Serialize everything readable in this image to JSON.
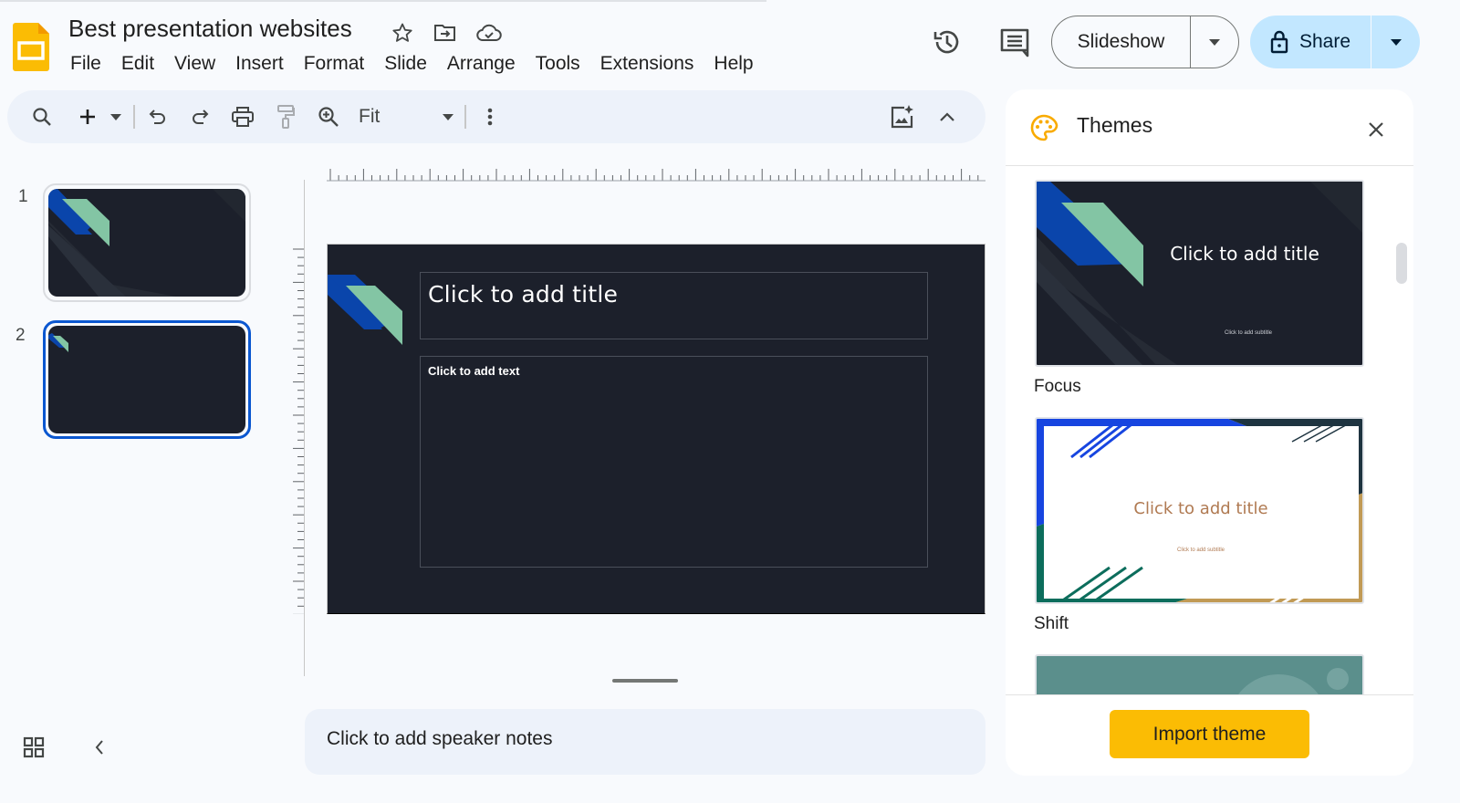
{
  "app": {
    "doc_title": "Best presentation websites",
    "logo_icon": "google-slides-logo",
    "title_icons": [
      "star-icon",
      "move-to-folder-icon",
      "cloud-saved-icon"
    ]
  },
  "menu": [
    "File",
    "Edit",
    "View",
    "Insert",
    "Format",
    "Slide",
    "Arrange",
    "Tools",
    "Extensions",
    "Help"
  ],
  "header_actions": {
    "history_icon": "version-history-icon",
    "comments_icon": "comments-icon",
    "slideshow_label": "Slideshow",
    "share_label": "Share",
    "share_icon": "lock-icon"
  },
  "toolbar": {
    "items": [
      "search-icon",
      "new-slide-plus-icon",
      "undo-icon",
      "redo-icon",
      "print-icon",
      "paint-format-icon",
      "zoom-icon"
    ],
    "zoom_value": "Fit",
    "more_icon": "more-vert-icon",
    "right_icons": [
      "ai-image-icon",
      "collapse-toolbar-icon"
    ]
  },
  "filmstrip": {
    "slides": [
      {
        "number": "1",
        "selected": false
      },
      {
        "number": "2",
        "selected": true
      }
    ]
  },
  "slide": {
    "title_placeholder": "Click to add title",
    "body_placeholder": "Click to add text"
  },
  "notes": {
    "placeholder": "Click to add speaker notes"
  },
  "themes_panel": {
    "title": "Themes",
    "themes": [
      {
        "name": "Focus",
        "title": "Click to add title",
        "subtitle": "Click to add subtitle"
      },
      {
        "name": "Shift",
        "title": "Click to add title",
        "subtitle": "Click to add subtitle"
      },
      {
        "name": "",
        "title": "",
        "subtitle": ""
      }
    ],
    "import_label": "Import theme"
  },
  "colors": {
    "accent_blue": "#0b57d0",
    "share_bg": "#c2e7ff",
    "import_btn": "#fbbc04",
    "slide_bg": "#1c202b",
    "focus_blue": "#0a45ab",
    "focus_green": "#83c5a4"
  }
}
